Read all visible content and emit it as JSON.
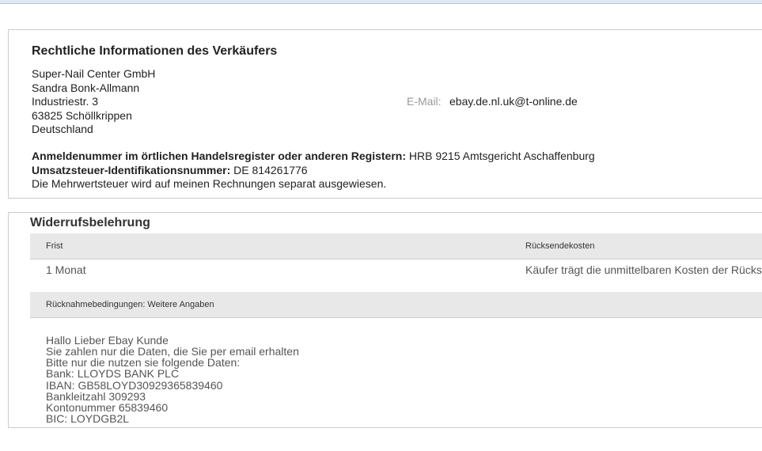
{
  "legal": {
    "title": "Rechtliche Informationen des Verkäufers",
    "address_lines": [
      "Super-Nail Center GmbH",
      "Sandra Bonk-Allmann",
      "Industriestr. 3",
      "63825 Schöllkrippen",
      "Deutschland"
    ],
    "email_label": "E-Mail:",
    "email_value": "ebay.de.nl.uk@t-online.de",
    "register_label": "Anmeldenummer im örtlichen Handelsregister oder anderen Registern:",
    "register_value": " HRB 9215 Amtsgericht Aschaffenburg",
    "vat_label": "Umsatzsteuer-Identifikationsnummer:",
    "vat_value": " DE 814261776",
    "vat_note": "Die Mehrwertsteuer wird auf meinen Rechnungen separat ausgewiesen."
  },
  "withdrawal": {
    "title": "Widerrufsbelehrung",
    "columns": [
      "Frist",
      "Rücksendekosten"
    ],
    "row": [
      "1 Monat",
      "Käufer trägt die unmittelbaren Kosten der Rücksendung"
    ],
    "conditions_header": "Rücknahmebedingungen: Weitere Angaben",
    "info_lines": [
      "Hallo Lieber Ebay Kunde",
      "Sie zahlen nur die Daten, die Sie per email erhalten",
      "Bitte nur die nutzen sie folgende Daten:",
      "Bank: LLOYDS BANK PLC",
      "IBAN: GB58LOYD30929365839460",
      "Bankleitzahl 309293",
      "Kontonummer 65839460",
      "BIC: LOYDGB2L"
    ]
  }
}
